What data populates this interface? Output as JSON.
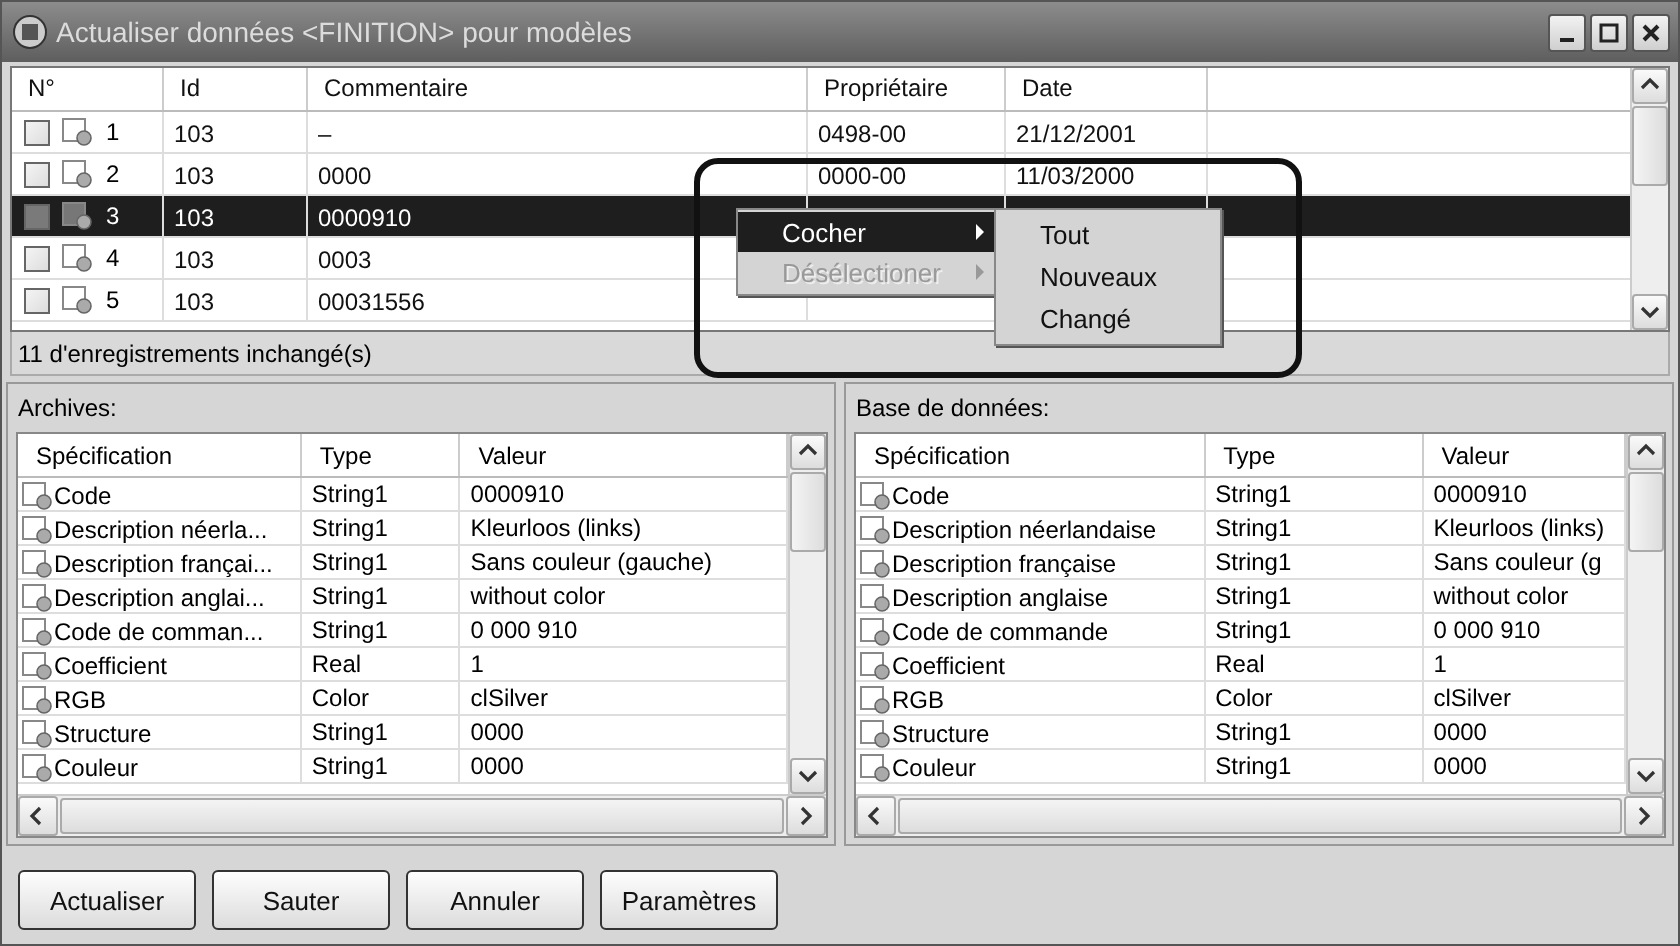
{
  "window": {
    "title": "Actualiser données <FINITION> pour modèles"
  },
  "records": {
    "columns": [
      "N°",
      "Id",
      "Commentaire",
      "Propriétaire",
      "Date"
    ],
    "rows": [
      {
        "cells": [
          "1",
          "103",
          "–",
          "0498-00",
          "21/12/2001"
        ],
        "selected": false
      },
      {
        "cells": [
          "2",
          "103",
          "0000",
          "0000-00",
          "11/03/2000"
        ],
        "selected": false
      },
      {
        "cells": [
          "3",
          "103",
          "0000910"
        ],
        "selected": true
      },
      {
        "cells": [
          "4",
          "103",
          "0003"
        ],
        "selected": false
      },
      {
        "cells": [
          "5",
          "103",
          "00031556"
        ],
        "selected": false
      }
    ]
  },
  "status_bar": "11 d'enregistrements inchangé(s)",
  "context_menu": {
    "items": [
      {
        "label": "Cocher",
        "selected": true,
        "disabled": false,
        "submenu": true
      },
      {
        "label": "Désélectioner",
        "selected": false,
        "disabled": true,
        "submenu": true
      }
    ],
    "submenu": [
      {
        "label": "Tout"
      },
      {
        "label": "Nouveaux"
      },
      {
        "label": "Changé"
      }
    ]
  },
  "panels": [
    {
      "title": "Archives:",
      "columns": [
        "Spécification",
        "Type",
        "Valeur"
      ],
      "rows": [
        [
          "Code",
          "String1",
          "0000910"
        ],
        [
          "Description néerla...",
          "String1",
          "Kleurloos (links)"
        ],
        [
          "Description françai...",
          "String1",
          "Sans couleur (gauche)"
        ],
        [
          "Description anglai...",
          "String1",
          "without color"
        ],
        [
          "Code de comman...",
          "String1",
          "0 000 910"
        ],
        [
          "Coefficient",
          "Real",
          "1"
        ],
        [
          "RGB",
          "Color",
          "clSilver"
        ],
        [
          "Structure",
          "String1",
          "0000"
        ],
        [
          "Couleur",
          "String1",
          "0000"
        ]
      ]
    },
    {
      "title": "Base de données:",
      "columns": [
        "Spécification",
        "Type",
        "Valeur"
      ],
      "rows": [
        [
          "Code",
          "String1",
          "0000910"
        ],
        [
          "Description néerlandaise",
          "String1",
          "Kleurloos (links)"
        ],
        [
          "Description française",
          "String1",
          "Sans couleur (g"
        ],
        [
          "Description anglaise",
          "String1",
          "without color"
        ],
        [
          "Code de commande",
          "String1",
          "0 000 910"
        ],
        [
          "Coefficient",
          "Real",
          "1"
        ],
        [
          "RGB",
          "Color",
          "clSilver"
        ],
        [
          "Structure",
          "String1",
          "0000"
        ],
        [
          "Couleur",
          "String1",
          "0000"
        ]
      ]
    }
  ],
  "buttons": [
    "Actualiser",
    "Sauter",
    "Annuler",
    "Paramètres"
  ]
}
